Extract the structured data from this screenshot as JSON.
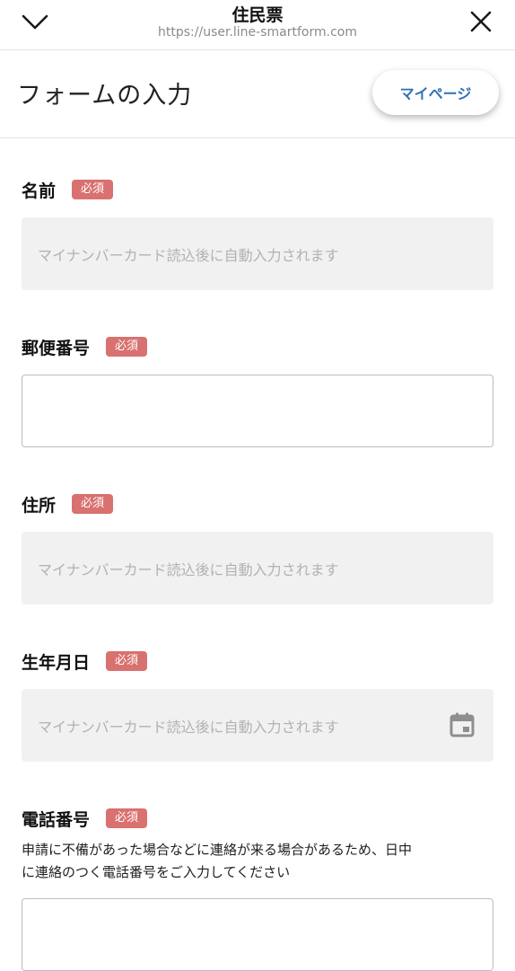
{
  "topbar": {
    "title": "住民票",
    "url": "https://user.line-smartform.com"
  },
  "header": {
    "title": "フォームの入力",
    "mypage_label": "マイページ"
  },
  "fields": {
    "name": {
      "label": "名前",
      "badge": "必須",
      "placeholder": "マイナンバーカード読込後に自動入力されます"
    },
    "postal": {
      "label": "郵便番号",
      "badge": "必須",
      "value": ""
    },
    "address": {
      "label": "住所",
      "badge": "必須",
      "placeholder": "マイナンバーカード読込後に自動入力されます"
    },
    "birthdate": {
      "label": "生年月日",
      "badge": "必須",
      "placeholder": "マイナンバーカード読込後に自動入力されます"
    },
    "phone": {
      "label": "電話番号",
      "badge": "必須",
      "help_line1": "申請に不備があった場合などに連絡が来る場合があるため、日中",
      "help_line2": "に連絡のつく電話番号をご入力してください"
    }
  },
  "colors": {
    "accent": "#2f6fb4",
    "badge": "#d8716f",
    "readonly_bg": "#f1f1f1",
    "placeholder": "#b2b2b2"
  }
}
